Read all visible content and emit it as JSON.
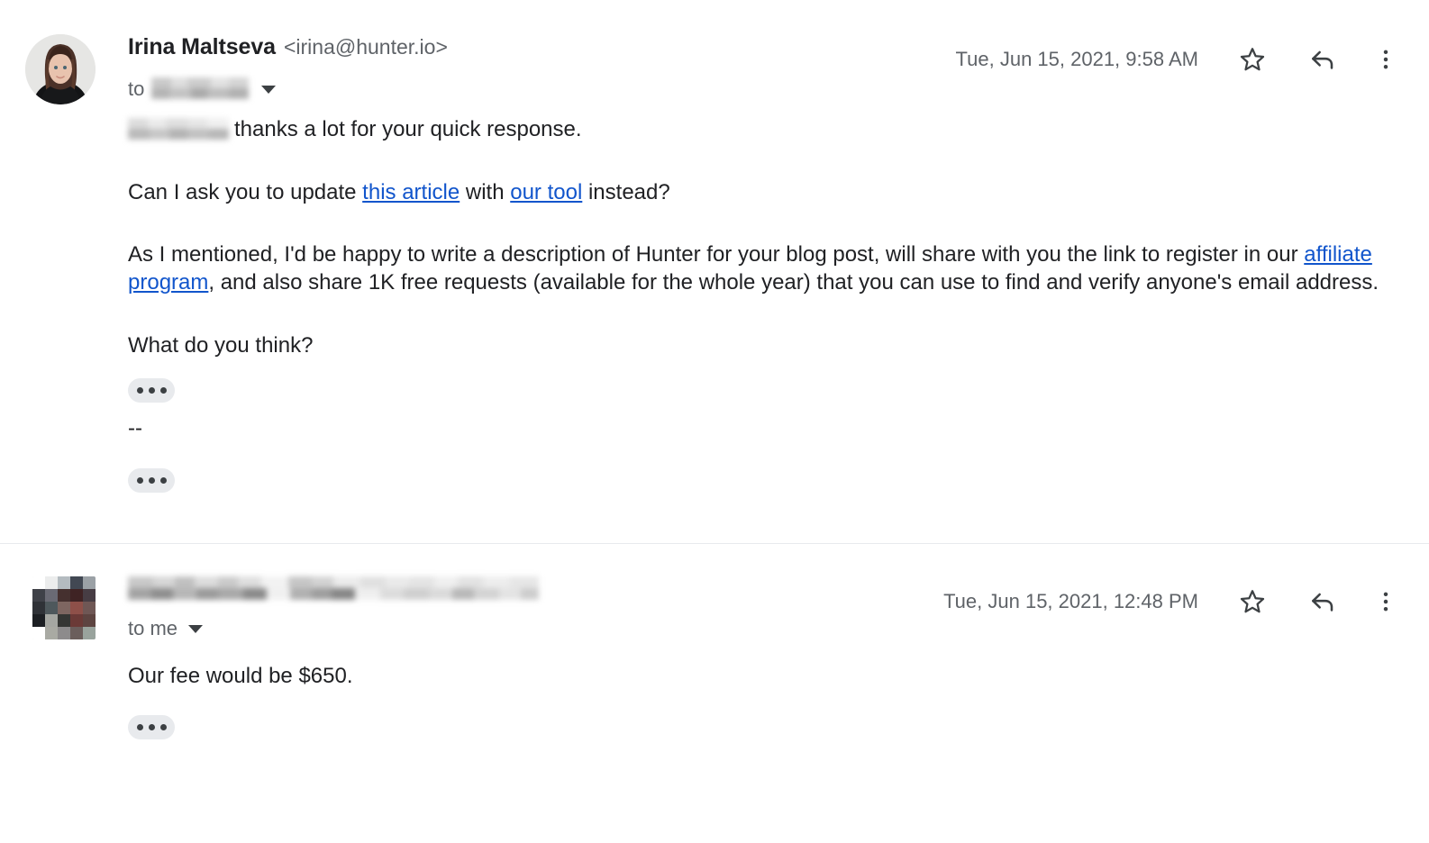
{
  "thread": {
    "messages": [
      {
        "sender_name": "Irina Maltseva",
        "sender_email": "<irina@hunter.io>",
        "recipient_label": "to",
        "recipient_redacted": true,
        "timestamp": "Tue, Jun 15, 2021, 9:58 AM",
        "body": {
          "greeting_suffix": "thanks a lot for your quick response.",
          "para2_pre": "Can I ask you to update ",
          "para2_link1": "this article",
          "para2_mid": " with ",
          "para2_link2": "our tool",
          "para2_post": " instead?",
          "para3_pre": "As I mentioned, I'd be happy to write a description of Hunter for your blog post, will share with you the link to register in our ",
          "para3_link": "affiliate program",
          "para3_post": ", and also share 1K free requests (available for the whole year) that you can use to find and verify anyone's email address.",
          "para4": "What do you think?",
          "signature_dashes": "--"
        }
      },
      {
        "sender_name_redacted": true,
        "recipient_label": "to me",
        "timestamp": "Tue, Jun 15, 2021, 12:48 PM",
        "body": {
          "para1": "Our fee would be $650."
        }
      }
    ]
  },
  "icons": {
    "star": "star-icon",
    "reply": "reply-icon",
    "more": "more-vertical-icon",
    "caret": "chevron-down-icon",
    "trim": "show-trimmed-content-icon"
  },
  "colors": {
    "link": "#1155cc",
    "text_primary": "#202124",
    "text_secondary": "#5f6368",
    "divider": "#e8eaed",
    "pill_bg": "#e8eaed",
    "background": "#ffffff"
  }
}
